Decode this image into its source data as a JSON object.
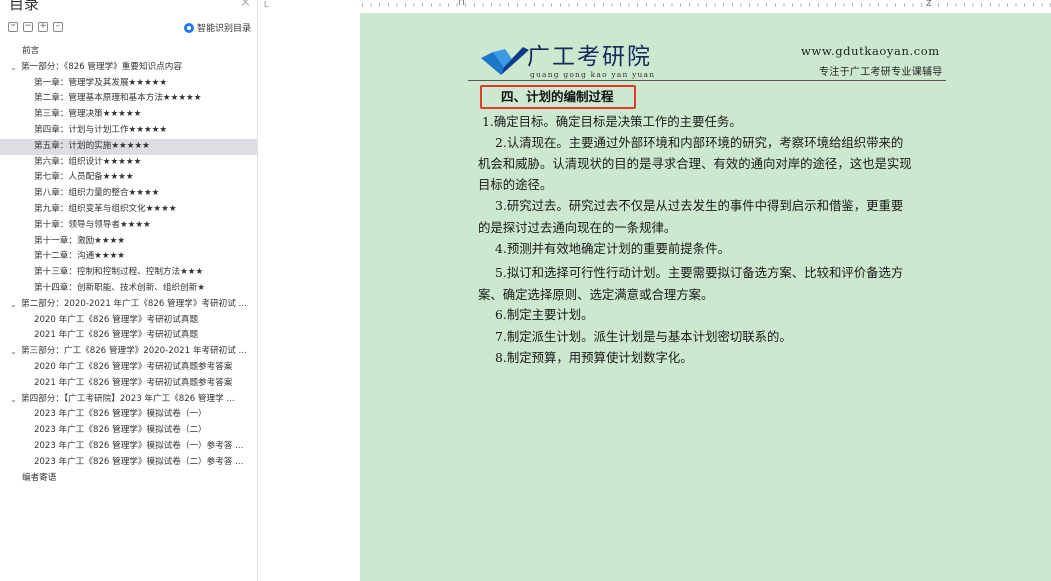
{
  "sidebar": {
    "title": "目录",
    "close_glyph": "×",
    "smart_toc_label": "智能识别目录",
    "toc": [
      {
        "label": "前言",
        "level": 0,
        "caret": false
      },
      {
        "label": "第一部分：《826 管理学》重要知识点内容",
        "level": 0,
        "caret": true
      },
      {
        "label": "第一章：管理学及其发展★★★★★",
        "level": 1
      },
      {
        "label": "第二章：管理基本原理和基本方法★★★★★",
        "level": 1
      },
      {
        "label": "第三章：管理决策★★★★★",
        "level": 1
      },
      {
        "label": "第四章：计划与计划工作★★★★★",
        "level": 1
      },
      {
        "label": "第五章：计划的实施★★★★★",
        "level": 1,
        "selected": true
      },
      {
        "label": "第六章：组织设计★★★★★",
        "level": 1
      },
      {
        "label": "第七章：人员配备★★★★",
        "level": 1
      },
      {
        "label": "第八章：组织力量的整合★★★★",
        "level": 1
      },
      {
        "label": "第九章：组织变革与组织文化★★★★",
        "level": 1
      },
      {
        "label": "第十章：领导与领导者★★★★",
        "level": 1
      },
      {
        "label": "第十一章：激励★★★★",
        "level": 1
      },
      {
        "label": "第十二章：沟通★★★★",
        "level": 1
      },
      {
        "label": "第十三章：控制和控制过程、控制方法★★★",
        "level": 1
      },
      {
        "label": "第十四章：创新职能、技术创新、组织创新★",
        "level": 1
      },
      {
        "label": "第二部分：2020-2021 年广工《826 管理学》考研初试 ...",
        "level": 0,
        "caret": true
      },
      {
        "label": "2020 年广工《826 管理学》考研初试真题",
        "level": 1
      },
      {
        "label": "2021 年广工《826 管理学》考研初试真题",
        "level": 1
      },
      {
        "label": "第三部分：广工《826 管理学》2020-2021 年考研初试 ...",
        "level": 0,
        "caret": true
      },
      {
        "label": "2020 年广工《826 管理学》考研初试真题参考答案",
        "level": 1
      },
      {
        "label": "2021 年广工《826 管理学》考研初试真题参考答案",
        "level": 1
      },
      {
        "label": "第四部分：【广工考研院】2023 年广工《826 管理学 ...",
        "level": 0,
        "caret": true
      },
      {
        "label": "2023 年广工《826 管理学》模拟试卷（一）",
        "level": 1
      },
      {
        "label": "2023 年广工《826 管理学》模拟试卷（二）",
        "level": 1
      },
      {
        "label": "2023 年广工《826 管理学》模拟试卷（一）参考答 ...",
        "level": 1
      },
      {
        "label": "2023 年广工《826 管理学》模拟试卷（二）参考答 ...",
        "level": 1
      },
      {
        "label": "编者寄语",
        "level": 0,
        "caret": false
      }
    ]
  },
  "ruler": {
    "left_marker": "L",
    "z_marker": "Z"
  },
  "document": {
    "header": {
      "name": "广工考研院",
      "pinyin": "guang gong kao yan yuan",
      "url": "www.gdutkaoyan.com",
      "slogan": "专注于广工考研专业课辅导"
    },
    "section_title": "四、计划的编制过程",
    "lines": [
      "1.确定目标。确定目标是决策工作的主要任务。",
      "2.认清现在。主要通过外部环境和内部环境的研究，考察环境给组织带来的",
      "机会和威胁。认清现状的目的是寻求合理、有效的通向对岸的途径，这也是实现",
      "目标的途径。",
      "3.研究过去。研究过去不仅是从过去发生的事件中得到启示和借鉴，更重要",
      "的是探讨过去通向现在的一条规律。",
      "4.预测并有效地确定计划的重要前提条件。",
      "5.拟订和选择可行性行动计划。主要需要拟订备选方案、比较和评价备选方",
      "案、确定选择原则、选定满意或合理方案。",
      "6.制定主要计划。",
      "7.制定派生计划。派生计划是与基本计划密切联系的。",
      "8.制定预算，用预算使计划数字化。"
    ]
  },
  "colors": {
    "page_bg": "#cce8cf",
    "highlight_box": "#e33b2b",
    "logo_blue": "#1b77c8",
    "selected_row": "#dcdee3",
    "accent": "#1e7cf0"
  }
}
